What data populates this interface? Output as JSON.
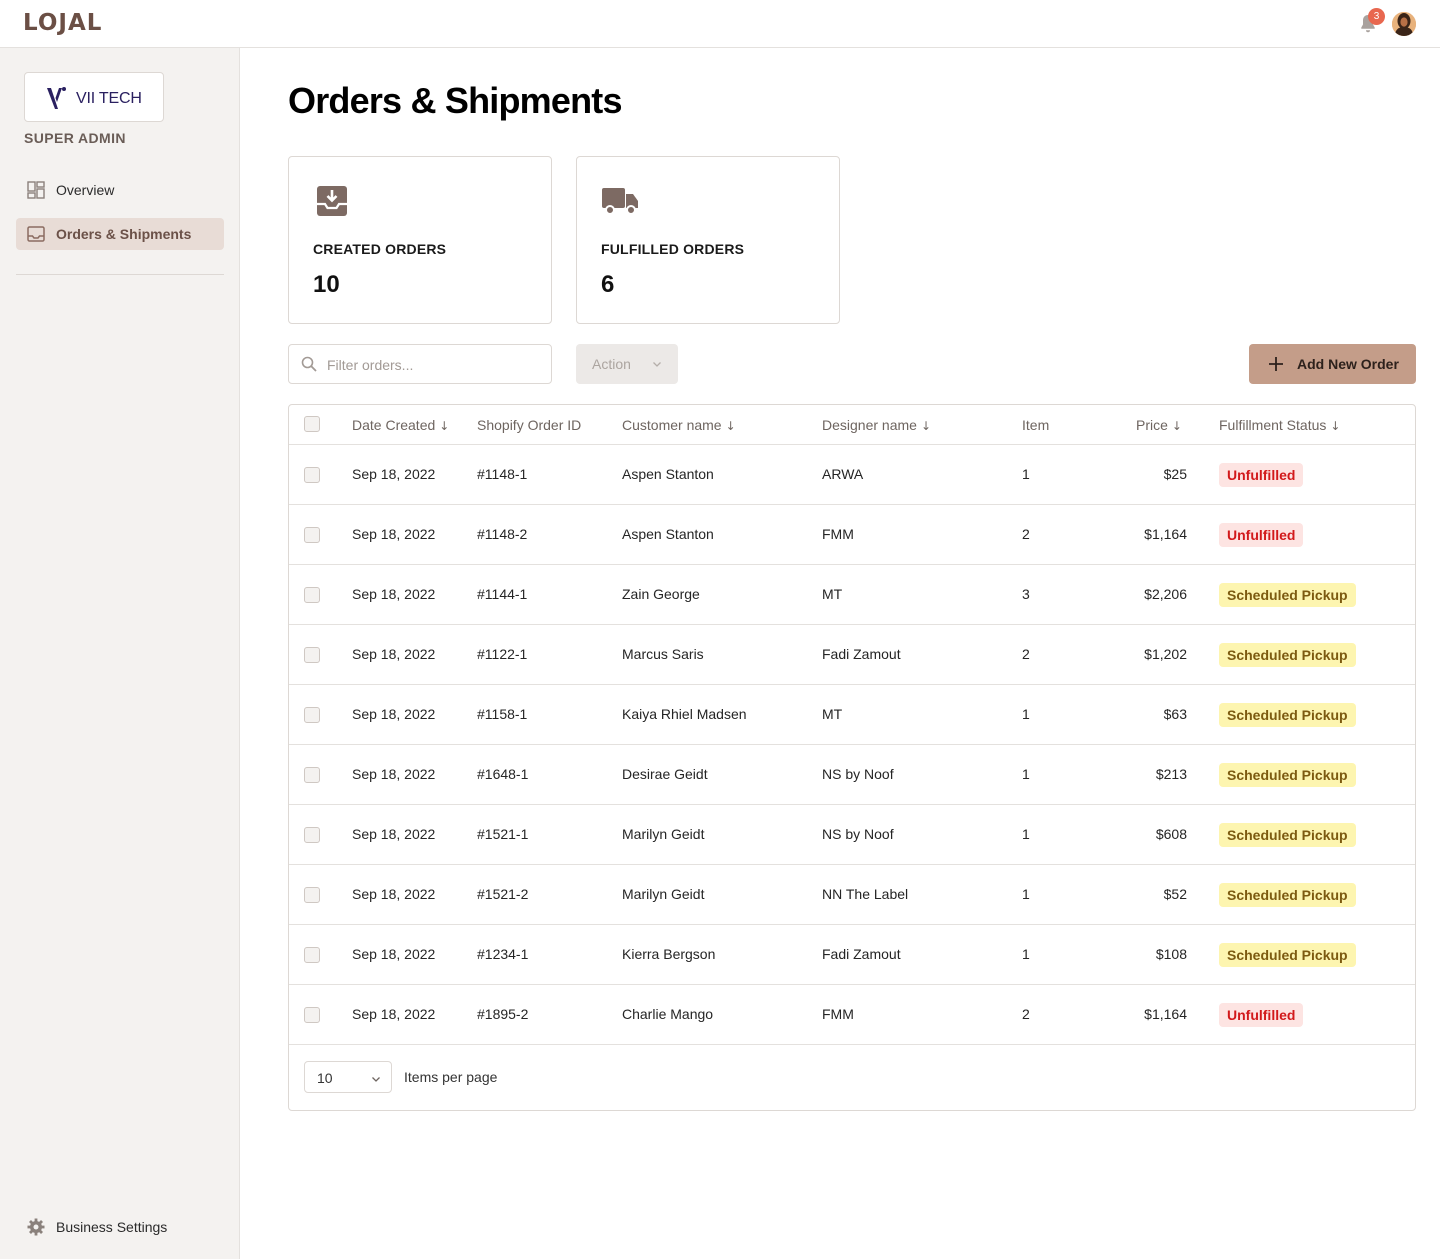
{
  "app": {
    "logo": "LOJAL",
    "notification_count": "3"
  },
  "sidebar": {
    "brand": "VII TECH",
    "role": "SUPER ADMIN",
    "items": [
      {
        "label": "Overview",
        "icon": "dashboard-icon",
        "active": false
      },
      {
        "label": "Orders & Shipments",
        "icon": "inbox-icon",
        "active": true
      }
    ],
    "settings_label": "Business Settings"
  },
  "page": {
    "title": "Orders & Shipments"
  },
  "stats": [
    {
      "label": "CREATED ORDERS",
      "value": "10",
      "icon": "inbox-download-icon"
    },
    {
      "label": "FULFILLED ORDERS",
      "value": "6",
      "icon": "truck-icon"
    }
  ],
  "toolbar": {
    "filter_placeholder": "Filter orders...",
    "action_label": "Action",
    "add_label": "Add New Order"
  },
  "table": {
    "columns": [
      "Date Created",
      "Shopify Order ID",
      "Customer name",
      "Designer name",
      "Item",
      "Price",
      "Fulfillment Status"
    ],
    "rows": [
      {
        "date": "Sep 18, 2022",
        "order_id": "#1148-1",
        "customer": "Aspen Stanton",
        "designer": "ARWA",
        "item": "1",
        "price": "$25",
        "status": "Unfulfilled"
      },
      {
        "date": "Sep 18, 2022",
        "order_id": "#1148-2",
        "customer": "Aspen Stanton",
        "designer": "FMM",
        "item": "2",
        "price": "$1,164",
        "status": "Unfulfilled"
      },
      {
        "date": "Sep 18, 2022",
        "order_id": "#1144-1",
        "customer": "Zain George",
        "designer": "MT",
        "item": "3",
        "price": "$2,206",
        "status": "Scheduled Pickup"
      },
      {
        "date": "Sep 18, 2022",
        "order_id": "#1122-1",
        "customer": "Marcus Saris",
        "designer": "Fadi Zamout",
        "item": "2",
        "price": "$1,202",
        "status": "Scheduled Pickup"
      },
      {
        "date": "Sep 18, 2022",
        "order_id": "#1158-1",
        "customer": "Kaiya Rhiel Madsen",
        "designer": "MT",
        "item": "1",
        "price": "$63",
        "status": "Scheduled Pickup"
      },
      {
        "date": "Sep 18, 2022",
        "order_id": "#1648-1",
        "customer": "Desirae Geidt",
        "designer": "NS by Noof",
        "item": "1",
        "price": "$213",
        "status": "Scheduled Pickup"
      },
      {
        "date": "Sep 18, 2022",
        "order_id": "#1521-1",
        "customer": "Marilyn Geidt",
        "designer": "NS by Noof",
        "item": "1",
        "price": "$608",
        "status": "Scheduled Pickup"
      },
      {
        "date": "Sep 18, 2022",
        "order_id": "#1521-2",
        "customer": "Marilyn Geidt",
        "designer": "NN The Label",
        "item": "1",
        "price": "$52",
        "status": "Scheduled Pickup"
      },
      {
        "date": "Sep 18, 2022",
        "order_id": "#1234-1",
        "customer": "Kierra Bergson",
        "designer": "Fadi Zamout",
        "item": "1",
        "price": "$108",
        "status": "Scheduled Pickup"
      },
      {
        "date": "Sep 18, 2022",
        "order_id": "#1895-2",
        "customer": "Charlie Mango",
        "designer": "FMM",
        "item": "2",
        "price": "$1,164",
        "status": "Unfulfilled"
      }
    ],
    "per_page_value": "10",
    "per_page_label": "Items per page"
  },
  "colors": {
    "brand": "#6b4f45",
    "accent_button": "#c49d89",
    "unfulfilled_bg": "#fde4e2",
    "unfulfilled_text": "#d2191b",
    "scheduled_bg": "#fdf5b0",
    "scheduled_text": "#7c5a10"
  }
}
